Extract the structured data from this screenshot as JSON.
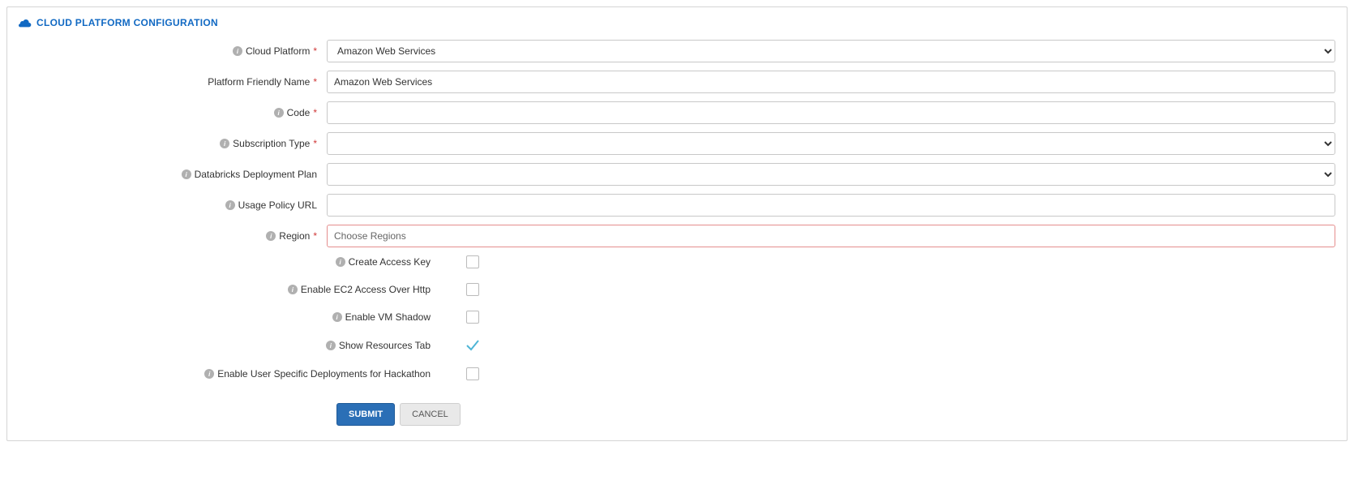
{
  "panel": {
    "title": "CLOUD PLATFORM CONFIGURATION"
  },
  "fields": {
    "cloud_platform": {
      "label": "Cloud Platform",
      "value": "Amazon Web Services",
      "required": true
    },
    "platform_friendly_name": {
      "label": "Platform Friendly Name",
      "value": "Amazon Web Services",
      "required": true
    },
    "code": {
      "label": "Code",
      "value": "",
      "required": true
    },
    "subscription_type": {
      "label": "Subscription Type",
      "value": "",
      "required": true
    },
    "databricks_deployment_plan": {
      "label": "Databricks Deployment Plan",
      "value": ""
    },
    "usage_policy_url": {
      "label": "Usage Policy URL",
      "value": ""
    },
    "region": {
      "label": "Region",
      "placeholder": "Choose Regions",
      "required": true
    },
    "create_access_key": {
      "label": "Create Access Key",
      "checked": false
    },
    "enable_ec2_http": {
      "label": "Enable EC2 Access Over Http",
      "checked": false
    },
    "enable_vm_shadow": {
      "label": "Enable VM Shadow",
      "checked": false
    },
    "show_resources_tab": {
      "label": "Show Resources Tab",
      "checked": true
    },
    "enable_user_hackathon": {
      "label": "Enable User Specific Deployments for Hackathon",
      "checked": false
    }
  },
  "buttons": {
    "submit": "SUBMIT",
    "cancel": "CANCEL"
  }
}
